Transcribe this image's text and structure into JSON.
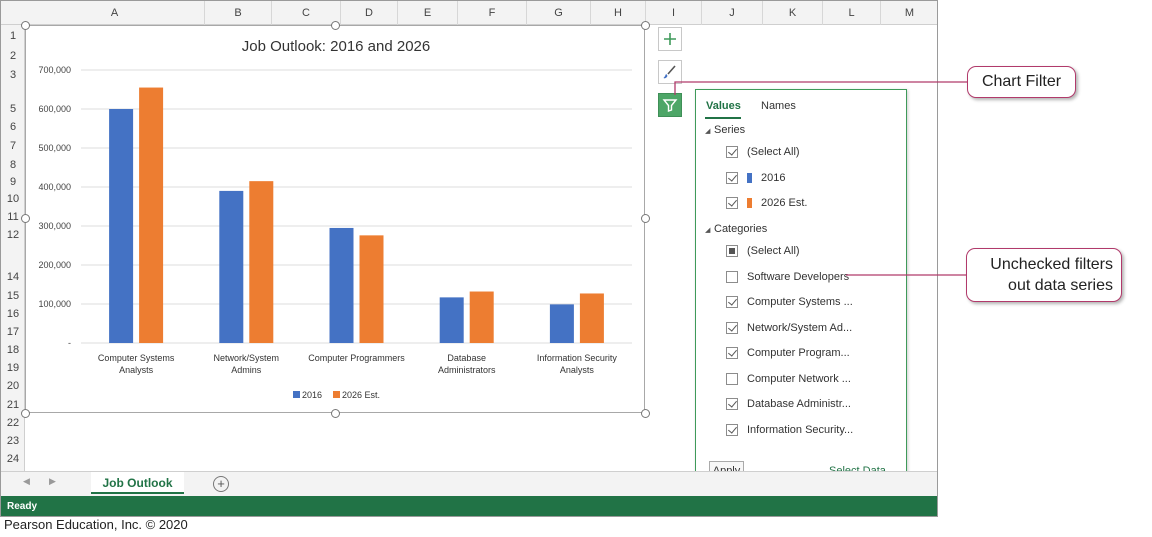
{
  "columns": [
    "A",
    "B",
    "C",
    "D",
    "E",
    "F",
    "G",
    "H",
    "I",
    "J",
    "K",
    "L",
    "M"
  ],
  "rows": [
    "1",
    "2",
    "3",
    "5",
    "6",
    "7",
    "8",
    "9",
    "10",
    "11",
    "12",
    "14",
    "15",
    "16",
    "17",
    "18",
    "19",
    "20",
    "21",
    "22",
    "23",
    "24"
  ],
  "chart_data": {
    "type": "bar",
    "title": "Job Outlook: 2016 and 2026",
    "categories": [
      "Computer Systems Analysts",
      "Network/System Admins",
      "Computer Programmers",
      "Database Administrators",
      "Information Security Analysts"
    ],
    "category_lines": [
      [
        "Computer Systems",
        "Analysts"
      ],
      [
        "Network/System",
        "Admins"
      ],
      [
        "Computer Programmers"
      ],
      [
        "Database",
        "Administrators"
      ],
      [
        "Information Security",
        "Analysts"
      ]
    ],
    "series": [
      {
        "name": "2016",
        "color": "#4472c4",
        "values": [
          600000,
          390000,
          295000,
          117000,
          99000
        ]
      },
      {
        "name": "2026 Est.",
        "color": "#ed7d31",
        "values": [
          655000,
          415000,
          276000,
          132000,
          127000
        ]
      }
    ],
    "ylim": [
      0,
      700000
    ],
    "yticks": [
      "-",
      "100,000",
      "200,000",
      "300,000",
      "400,000",
      "500,000",
      "600,000",
      "700,000"
    ],
    "grid": true,
    "legend_position": "bottom"
  },
  "filter_panel": {
    "tabs": [
      "Values",
      "Names"
    ],
    "series_title": "Series",
    "series_items": [
      {
        "label": "(Select All)",
        "state": "checked"
      },
      {
        "label": "2016",
        "state": "checked",
        "color": "#4472c4"
      },
      {
        "label": "2026 Est.",
        "state": "checked",
        "color": "#ed7d31"
      }
    ],
    "categories_title": "Categories",
    "category_items": [
      {
        "label": "(Select All)",
        "state": "partial"
      },
      {
        "label": "Software Developers",
        "state": "unchecked"
      },
      {
        "label": "Computer Systems ...",
        "state": "checked"
      },
      {
        "label": "Network/System Ad...",
        "state": "checked"
      },
      {
        "label": "Computer Program...",
        "state": "checked"
      },
      {
        "label": "Computer Network ...",
        "state": "unchecked"
      },
      {
        "label": "Database Administr...",
        "state": "checked"
      },
      {
        "label": "Information Security...",
        "state": "checked"
      }
    ],
    "apply_label": "Apply",
    "select_data_label": "Select Data..."
  },
  "chart_buttons": [
    "plus-icon",
    "brush-icon",
    "filter-icon"
  ],
  "sheet_tab": "Job Outlook",
  "status": "Ready",
  "callouts": {
    "chart_filter": "Chart Filter",
    "unchecked_line1": "Unchecked filters",
    "unchecked_line2": "out data series"
  },
  "copyright": "Pearson Education, Inc. © 2020",
  "colors": {
    "accent": "#217346",
    "filter_active": "#4da667",
    "callout_border": "#b13a6b"
  }
}
